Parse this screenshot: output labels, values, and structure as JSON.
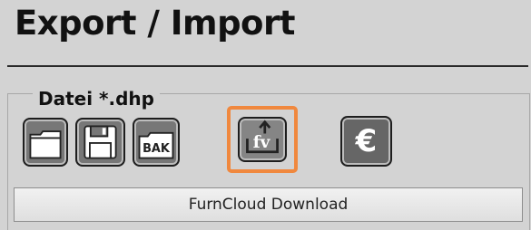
{
  "header": {
    "title": "Export / Import"
  },
  "file_group": {
    "label": "Datei *.dhp"
  },
  "icons": {
    "open": "folder-icon",
    "save": "floppy-disk-icon",
    "backup": "bak-icon",
    "backup_text": "BAK",
    "furncloud": "furncloud-upload-icon",
    "furncloud_letters": "fv",
    "price": "euro-icon",
    "euro_symbol": "€"
  },
  "buttons": {
    "furncloud_download": "FurnCloud Download"
  },
  "colors": {
    "background": "#d3d3d3",
    "highlight": "#f0883e",
    "icon_fill": "#777777"
  }
}
